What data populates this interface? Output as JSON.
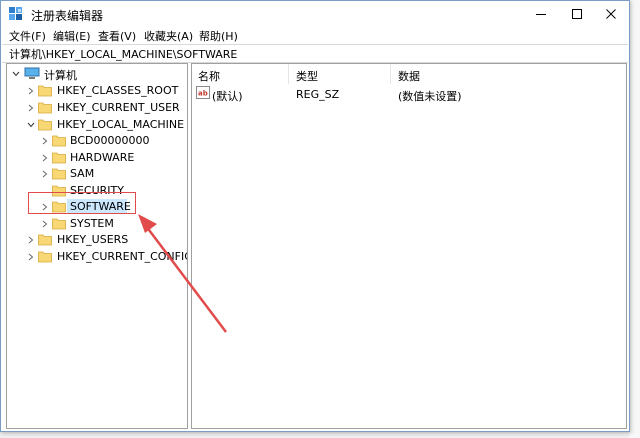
{
  "window": {
    "title": "注册表编辑器",
    "controls": {
      "minimize_icon": "minimize-icon",
      "maximize_icon": "maximize-icon",
      "close_icon": "close-icon"
    }
  },
  "menu": {
    "items": [
      {
        "label": "文件(F)"
      },
      {
        "label": "编辑(E)"
      },
      {
        "label": "查看(V)"
      },
      {
        "label": "收藏夹(A)"
      },
      {
        "label": "帮助(H)"
      }
    ]
  },
  "address": {
    "path": "计算机\\HKEY_LOCAL_MACHINE\\SOFTWARE"
  },
  "tree": {
    "root": {
      "label": "计算机",
      "expanded": true
    },
    "items": [
      {
        "label": "HKEY_CLASSES_ROOT",
        "level": 1,
        "expanded": false
      },
      {
        "label": "HKEY_CURRENT_USER",
        "level": 1,
        "expanded": false
      },
      {
        "label": "HKEY_LOCAL_MACHINE",
        "level": 1,
        "expanded": true
      },
      {
        "label": "BCD00000000",
        "level": 2,
        "expanded": false
      },
      {
        "label": "HARDWARE",
        "level": 2,
        "expanded": false
      },
      {
        "label": "SAM",
        "level": 2,
        "expanded": false
      },
      {
        "label": "SECURITY",
        "level": 2,
        "expanded": false
      },
      {
        "label": "SOFTWARE",
        "level": 2,
        "expanded": false,
        "selected": true
      },
      {
        "label": "SYSTEM",
        "level": 2,
        "expanded": false
      },
      {
        "label": "HKEY_USERS",
        "level": 1,
        "expanded": false
      },
      {
        "label": "HKEY_CURRENT_CONFIG",
        "level": 1,
        "expanded": false
      }
    ]
  },
  "values": {
    "columns": [
      "名称",
      "类型",
      "数据"
    ],
    "rows": [
      {
        "name": "(默认)",
        "type": "REG_SZ",
        "data": "(数值未设置)",
        "icon": "string-value-icon"
      }
    ]
  },
  "colors": {
    "selection": "#cce8ff",
    "highlight_annotation": "#e14b4b",
    "folder": "#f1c75a"
  }
}
